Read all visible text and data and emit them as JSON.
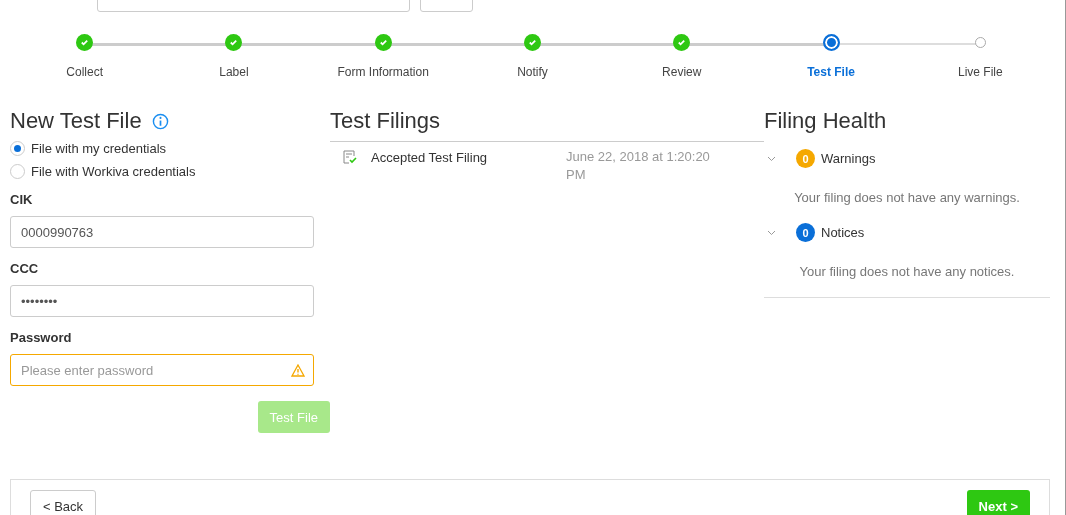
{
  "steps": [
    {
      "label": "Collect",
      "done": true,
      "selected": false
    },
    {
      "label": "Label",
      "done": true,
      "selected": false
    },
    {
      "label": "Form Information",
      "done": true,
      "selected": false
    },
    {
      "label": "Notify",
      "done": true,
      "selected": false
    },
    {
      "label": "Review",
      "done": true,
      "selected": false
    },
    {
      "label": "Test File",
      "done": false,
      "selected": true
    },
    {
      "label": "Live File",
      "done": false,
      "selected": false
    }
  ],
  "new_test_file": {
    "title": "New Test File",
    "options": [
      {
        "label": "File with my credentials",
        "selected": true
      },
      {
        "label": "File with Workiva credentials",
        "selected": false
      }
    ],
    "fields": [
      {
        "label": "CIK",
        "value": "0000990763",
        "warning": false
      },
      {
        "label": "CCC",
        "value": "••••••••",
        "warning": false
      },
      {
        "label": "Password",
        "placeholder": "Please enter password",
        "warning": true
      }
    ],
    "button": {
      "label": "Test File",
      "disabled": true
    }
  },
  "test_filings": {
    "title": "Test Filings",
    "rows": [
      {
        "name": "Accepted Test Filing",
        "date": "June 22, 2018 at 1:20:20 PM"
      }
    ]
  },
  "filing_health": {
    "title": "Filing Health",
    "sections": [
      {
        "count": "0",
        "label": "Warnings",
        "color": "#f5a800",
        "message": "Your filing does not have any warnings."
      },
      {
        "count": "0",
        "label": "Notices",
        "color": "#0a6fd8",
        "message": "Your filing does not have any notices."
      }
    ]
  },
  "footer": {
    "back": "< Back",
    "next": "Next >"
  }
}
